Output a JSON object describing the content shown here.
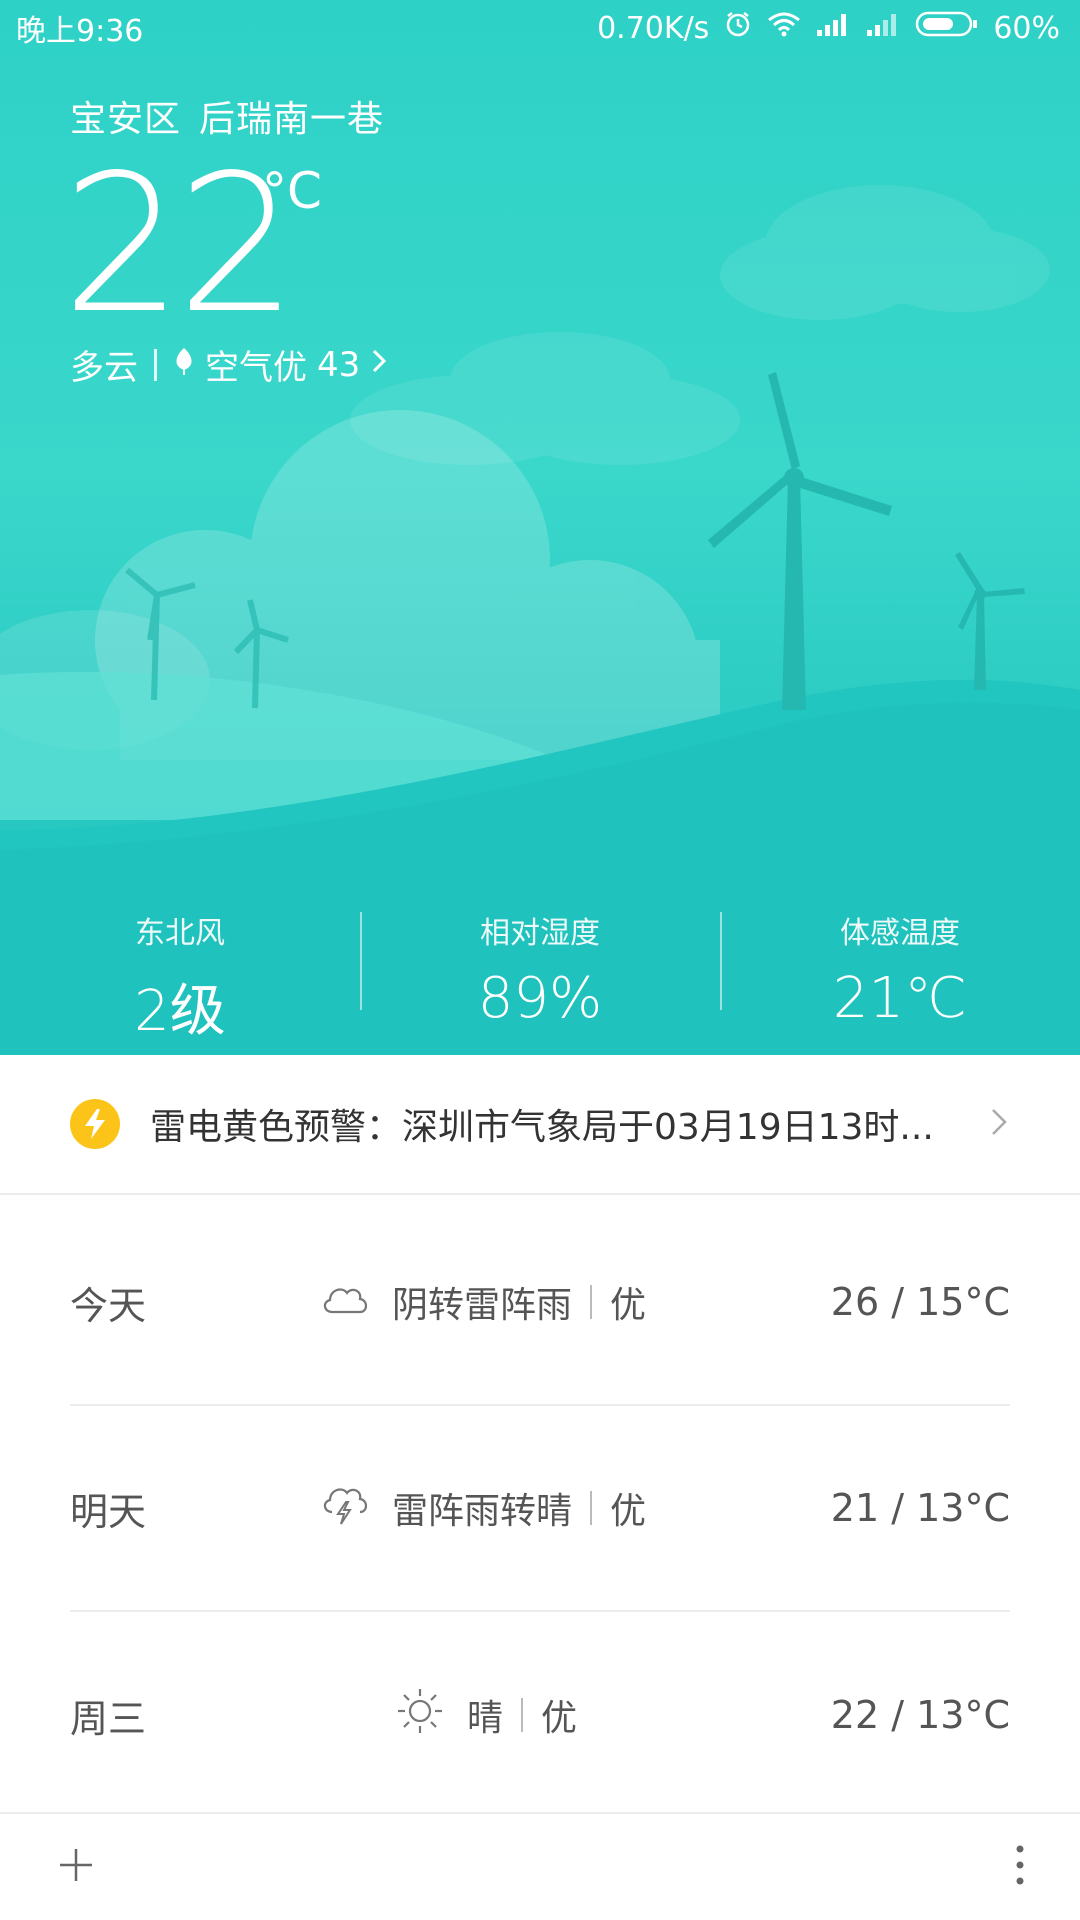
{
  "status_bar": {
    "time": "晚上9:36",
    "net_speed": "0.70K/s",
    "battery": "60%"
  },
  "current": {
    "location_district": "宝安区",
    "location_street": "后瑞南一巷",
    "temperature": "22",
    "unit": "°C",
    "condition": "多云",
    "air_label": "空气优",
    "aqi": "43"
  },
  "stats": [
    {
      "label": "东北风",
      "value": "2级"
    },
    {
      "label": "相对湿度",
      "value": "89%"
    },
    {
      "label": "体感温度",
      "value": "21℃"
    }
  ],
  "alert": {
    "text": "雷电黄色预警：深圳市气象局于03月19日13时...",
    "color": "#fcc419"
  },
  "forecast": [
    {
      "day": "今天",
      "icon": "cloud-icon",
      "weather": "阴转雷阵雨",
      "air": "优",
      "temps": "26 / 15°C"
    },
    {
      "day": "明天",
      "icon": "thunder-shower-icon",
      "weather": "雷阵雨转晴",
      "air": "优",
      "temps": "21 / 13°C"
    },
    {
      "day": "周三",
      "icon": "sun-icon",
      "weather": "晴",
      "air": "优",
      "temps": "22 / 13°C"
    }
  ],
  "colors": {
    "sky_top": "#2ed1c6",
    "sky_bottom": "#1ec0bd",
    "alert_yellow": "#fcc419"
  }
}
